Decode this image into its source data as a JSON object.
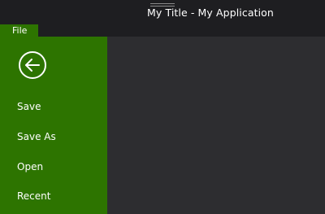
{
  "window": {
    "title": "My Title - My Application"
  },
  "menubar": {
    "file_tab": "File"
  },
  "backstage": {
    "back_icon": "arrow-left-circle-icon",
    "items": [
      {
        "label": "Save"
      },
      {
        "label": "Save As"
      },
      {
        "label": "Open"
      },
      {
        "label": "Recent"
      }
    ]
  },
  "colors": {
    "accent": "#2d7400",
    "titlebar": "#1e1e21",
    "content_bg": "#2d2d30",
    "text": "#ffffff"
  }
}
